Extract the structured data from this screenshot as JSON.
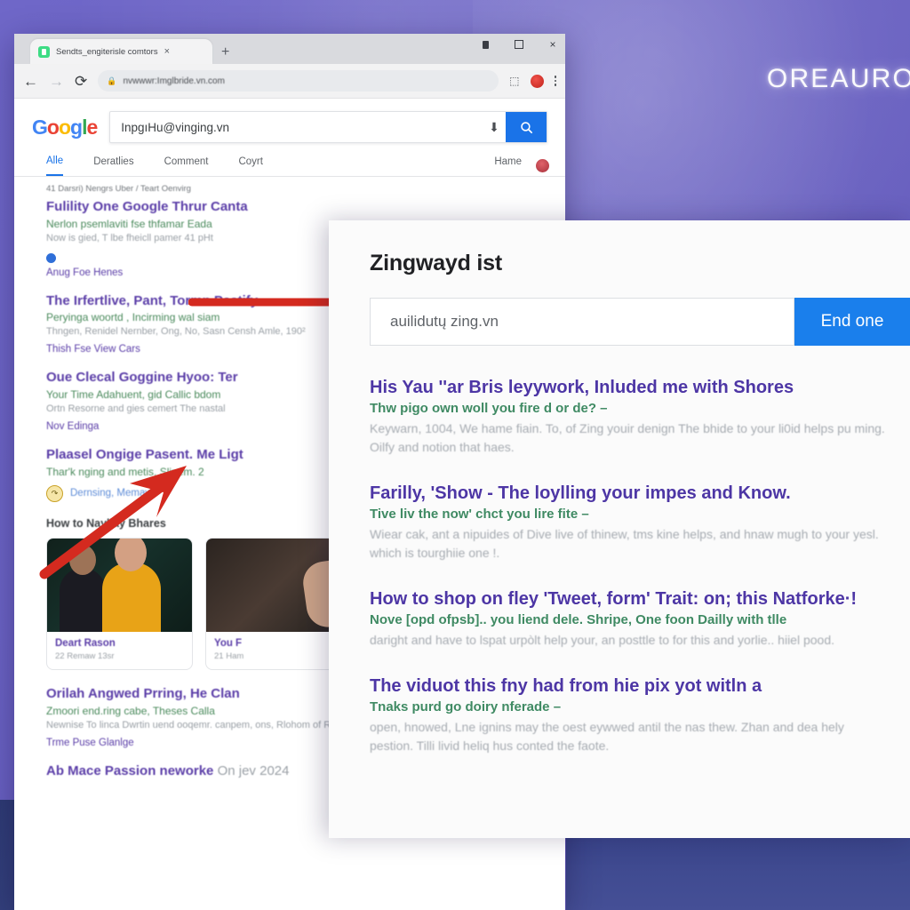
{
  "desktop": {
    "brand_text": "OREAURO",
    "background_color": "#6b63c4",
    "accent_navy": "#3b468c"
  },
  "browser": {
    "tab": {
      "title": "Sendts_engiterisle comtors",
      "favicon": "page-icon",
      "close_label": "×",
      "new_tab_label": "+"
    },
    "window_controls": {
      "minimize_label": "–",
      "maximize_label": "□",
      "close_label": "×"
    },
    "toolbar": {
      "back_label": "←",
      "forward_label": "→",
      "reload_label": "⟳",
      "lock_label": "🔒",
      "url": "nvwwwr:Imglbride.vn.com",
      "install_label": "⬚",
      "profile_label": "",
      "menu_label": ""
    }
  },
  "google": {
    "logo_letters": [
      {
        "ch": "G",
        "cls": "b"
      },
      {
        "ch": "o",
        "cls": "r"
      },
      {
        "ch": "o",
        "cls": "y"
      },
      {
        "ch": "g",
        "cls": "b"
      },
      {
        "ch": "l",
        "cls": "g"
      },
      {
        "ch": "e",
        "cls": "r"
      }
    ],
    "query": "InpgıHu@vinging.vn",
    "mic_label": "⬇",
    "search_button_label": "search-icon",
    "tabs": [
      {
        "label": "Alle",
        "active": true
      },
      {
        "label": "Deratlies",
        "active": false
      },
      {
        "label": "Comment",
        "active": false
      },
      {
        "label": "Coyrt",
        "active": false
      }
    ],
    "tabs_right": [
      {
        "label": "Hame"
      }
    ],
    "stats": "41 Darsri) Nengrs Uber / Teart Oenvirg"
  },
  "results": [
    {
      "title": "Fulility One Google Thrur Canta",
      "url": "Nerlon psemlaviti fse thfamar Eada",
      "snippet": "Now is gied, T lbe fheicll pamer 41 pHt",
      "bullet_text": "Anug Foe Henes",
      "has_bullet": true
    },
    {
      "title": "The Irfertlive, Pant, Tormn Pastify",
      "url": "Peryinga woortd , Incirming wal siam",
      "snippet": "Thngen, Renidel Nernber, Ong, No, Sasn Censh Amle,  190²",
      "link": "Thish Fse View Cars"
    },
    {
      "title": "Oue Clecal Goggine Hyoo: Ter",
      "url": "Your Time Adahuent, gid Callic bdom",
      "snippet": "Ortn Resorne and gies cemert The nastal",
      "link": "Nov Edinga"
    },
    {
      "title": "Plaasel Ongige Pasent. Me Ligt",
      "url": "Thar'k nging and metis. Slinem. 2",
      "chip": "Dernsing, Memawe",
      "chip_badge": "↷"
    }
  ],
  "video_section": {
    "heading": "How to Nayllay Bhares",
    "cards": [
      {
        "title": "Deart Rason",
        "meta": "22 Remaw 13sr"
      },
      {
        "title": "You F",
        "meta": "21 Ham"
      }
    ]
  },
  "results_tail": [
    {
      "title": "Orilah Angwed Prring, He Clan",
      "url": "Zmoori end.ring cabe, Theses Calla",
      "snippet": "Newnise To linca Dwrtin uend ooqemr. canpem, ons, Rlohom of Renolel Cansonts and Mounsa",
      "link": "Trme Puse Glanlge"
    },
    {
      "title": "Ab Mace Passion neworke",
      "url": "On jev 2024",
      "snippet": "",
      "link": ""
    }
  ],
  "overlay": {
    "title": "Zingwayd ist",
    "search_value": "auilidutų zing.vn",
    "search_placeholder": "zing.vn",
    "button_label": "End one",
    "results": [
      {
        "title": "His Yau ''ar Bris leyywork,  Inluded me with Shores",
        "url": "Thw pigo own woll you fire d or de? –",
        "snippet": "Keywarn, 1004, We hame fiain. To, of Zing youir denign The bhide to your li0id helps pu ming. Oilfy and notion that haes."
      },
      {
        "title": "Farilly, 'Show - The loylling your impes and Know.",
        "url": "Tive liv the now' chct you lire fite –",
        "snippet": "Wiear cak, ant a nipuides of Dive live of thinew, tms kine helps, and hnaw mugh to your yesl. which is tourghiie one !."
      },
      {
        "title": "How to shop on fley 'Tweet, form' Trait: on; this Natforke·!",
        "url": "Nove [opd ofpsb].. you liend dele. Shripe, One foon Dailly with tlle",
        "snippet": "daright and have to lspat urpòlt help your, an posttle to for this and yorlie.. hiiel pood."
      },
      {
        "title": "The viduot this fny had from hie pix yot witln a",
        "url": "Tnaks purd go doiry nferade –",
        "snippet": "open, hnowed, Lne ignins may the oest eywwed antil the nas thew. Zhan and dea hely pestion.  Tilli livid heliq hus conted the faote."
      }
    ]
  },
  "annotations": {
    "arrow_color": "#d42a1f",
    "arrow_top_label": "pointer-arrow-horizontal",
    "arrow_bottom_label": "pointer-arrow-diagonal"
  }
}
